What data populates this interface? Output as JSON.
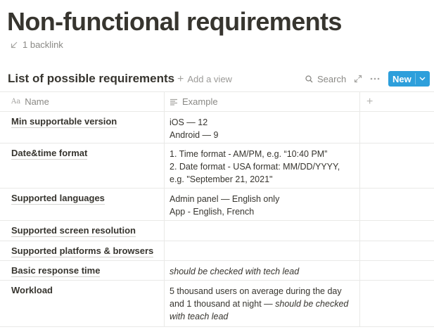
{
  "page": {
    "title": "Non-functional requirements",
    "backlinks": "1 backlink"
  },
  "database": {
    "title": "List of possible requirements",
    "add_view": "Add a view",
    "search": "Search",
    "new_button": "New",
    "accent_color": "#2d9fdb"
  },
  "table": {
    "columns": [
      {
        "label": "Name",
        "icon": "text-type-icon"
      },
      {
        "label": "Example",
        "icon": "text-lines-icon"
      }
    ],
    "rows": [
      {
        "name": "Min supportable version",
        "example_lines": [
          "iOS — 12",
          "Android — 9"
        ]
      },
      {
        "name": "Date&time format",
        "example_lines": [
          "1. Time format - AM/PM, e.g. “10:40 PM”",
          "2. Date format - USA format: MM/DD/YYYY,",
          "e.g. \"September 21, 2021\""
        ]
      },
      {
        "name": "Supported languages",
        "example_lines": [
          "Admin panel — English only",
          "App - English, French"
        ]
      },
      {
        "name": "Supported screen resolution",
        "example_lines": []
      },
      {
        "name": "Supported platforms & browsers",
        "example_lines": []
      },
      {
        "name": "Basic response time",
        "example_italic": "should be checked with tech lead"
      },
      {
        "name": "Workload",
        "example_line1": "5 thousand users on average during the day",
        "example_line2_plain": "and 1 thousand at night — ",
        "example_line2_italic": "should be checked",
        "example_line3_italic": "with teach lead"
      }
    ]
  }
}
